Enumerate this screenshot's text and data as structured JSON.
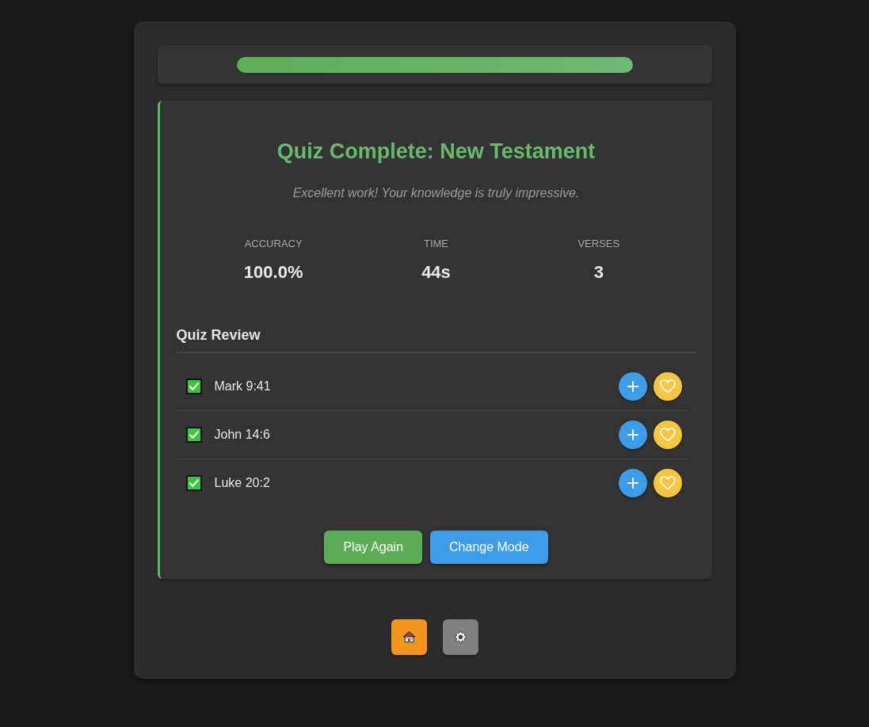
{
  "progress": {
    "level": 1
  },
  "result": {
    "title": "Quiz Complete: New Testament",
    "message": "Excellent work! Your knowledge is truly impressive.",
    "stats": [
      {
        "label": "ACCURACY",
        "value": "100.0%"
      },
      {
        "label": "TIME",
        "value": "44s"
      },
      {
        "label": "VERSES",
        "value": "3"
      }
    ]
  },
  "review": {
    "heading": "Quiz Review",
    "items": [
      {
        "reference": "Mark 9:41",
        "checked": true
      },
      {
        "reference": "John 14:6",
        "checked": true
      },
      {
        "reference": "Luke 20:2",
        "checked": true
      }
    ]
  },
  "actions": [
    {
      "label": "Play Again",
      "kind": "primary"
    },
    {
      "label": "Change Mode",
      "kind": "secondary"
    }
  ],
  "nav": [
    {
      "kind": "home"
    },
    {
      "kind": "settings"
    }
  ]
}
